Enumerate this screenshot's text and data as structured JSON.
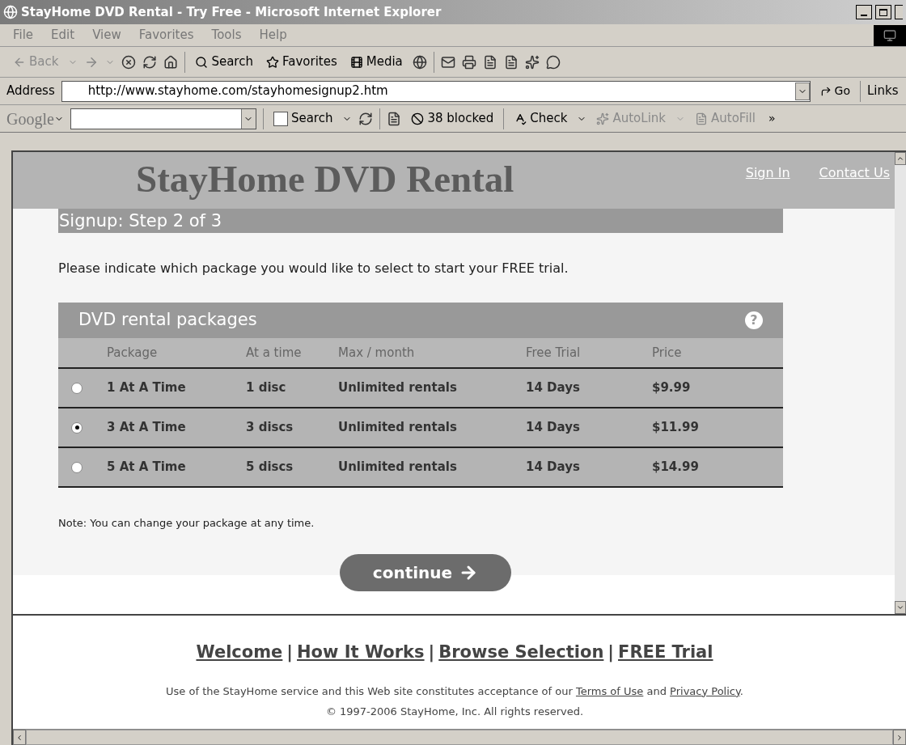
{
  "window": {
    "title": "StayHome DVD Rental - Try Free - Microsoft Internet Explorer"
  },
  "menu": [
    "File",
    "Edit",
    "View",
    "Favorites",
    "Tools",
    "Help"
  ],
  "toolbar": {
    "back": "Back",
    "search": "Search",
    "favorites": "Favorites",
    "media": "Media"
  },
  "address_bar": {
    "label": "Address",
    "url": "http://www.stayhome.com/stayhomesignup2.htm",
    "go": "Go",
    "links": "Links"
  },
  "google_toolbar": {
    "logo": "Google",
    "search": "Search",
    "blocked": "38 blocked",
    "check": "Check",
    "autolink": "AutoLink",
    "autofill": "AutoFill",
    "more": "»"
  },
  "site": {
    "title": "StayHome DVD Rental",
    "header_links": [
      "Sign In",
      "Contact Us"
    ],
    "step_heading": "Signup: Step 2 of 3",
    "intro": "Please indicate which package you would like to select to start your FREE trial.",
    "packages": {
      "title": "DVD rental packages",
      "help": "?",
      "columns": [
        "Package",
        "At a time",
        "Max / month",
        "Free Trial",
        "Price"
      ],
      "rows": [
        {
          "selected": false,
          "cells": [
            "1 At A Time",
            "1 disc",
            "Unlimited rentals",
            "14 Days",
            "$9.99"
          ]
        },
        {
          "selected": true,
          "cells": [
            "3 At A Time",
            "3 discs",
            "Unlimited rentals",
            "14 Days",
            "$11.99"
          ]
        },
        {
          "selected": false,
          "cells": [
            "5 At A Time",
            "5 discs",
            "Unlimited rentals",
            "14 Days",
            "$14.99"
          ]
        }
      ]
    },
    "note": "Note: You can change your package at any time.",
    "continue": "continue",
    "footer_nav": {
      "links": [
        "Welcome",
        "How It Works",
        "Browse Selection",
        "FREE Trial"
      ],
      "separator": "|"
    },
    "legal": {
      "before": "Use of the StayHome service and this Web site constitutes acceptance of our ",
      "terms": "Terms of Use",
      "middle": " and ",
      "privacy": "Privacy Policy",
      "after": "."
    },
    "copyright": "© 1997-2006 StayHome, Inc. All rights reserved."
  }
}
